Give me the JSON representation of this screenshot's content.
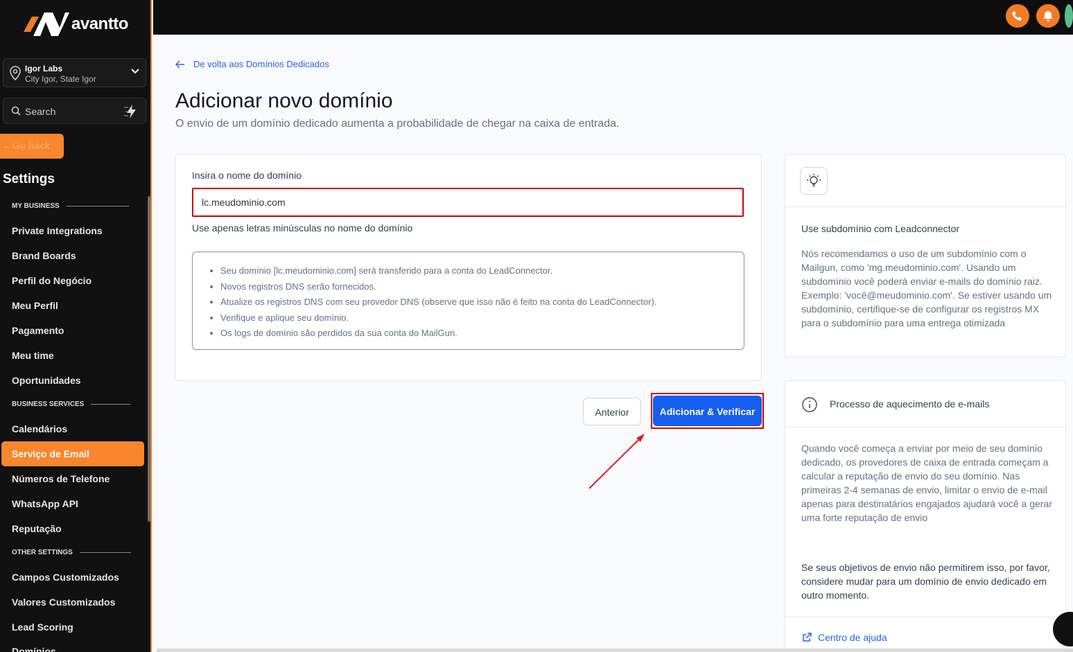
{
  "brand": {
    "name": "avantto"
  },
  "location": {
    "name": "Igor Labs",
    "address": "City Igor, State Igor"
  },
  "search": {
    "label": "Search"
  },
  "sidebar": {
    "go_back": "Go Back",
    "title": "Settings",
    "sections": {
      "my_business": "MY BUSINESS",
      "business_services": "BUSINESS SERVICES",
      "other_settings": "OTHER SETTINGS"
    },
    "items": [
      "Private Integrations",
      "Brand Boards",
      "Perfil do Negócio",
      "Meu Perfil",
      "Pagamento",
      "Meu time",
      "Oportunidades",
      "Calendários",
      "Serviço de Email",
      "Números de Telefone",
      "WhatsApp API",
      "Reputação",
      "Campos Customizados",
      "Valores Customizados",
      "Lead Scoring",
      "Domínios"
    ]
  },
  "main": {
    "back_link": "De volta aos Domínios Dedicados",
    "title": "Adicionar novo domínio",
    "subtitle": "O envio de um domínio dedicado aumenta a probabilidade de chegar na caixa de entrada.",
    "domain_label": "Insira o nome do domínio",
    "domain_value": "lc.meudominio.com",
    "domain_hint": "Use apenas letras minúsculas no nome do domínio",
    "info_items": [
      "Seu domínio [lc.meudominio.com] será transferido para a conta do LeadConnector.",
      "Novos registros DNS serão fornecidos.",
      "Atualize os registros DNS com seu provedor DNS (observe que isso não é feito na conta do LeadConnector).",
      "Verifique e aplique seu domínio.",
      "Os logs de domínio são perdidos da sua conta do MailGun."
    ],
    "btn_prev": "Anterior",
    "btn_submit": "Adicionar & Verificar"
  },
  "tips": {
    "subdomain_title": "Use subdomínio com Leadconnector",
    "subdomain_body": "Nós recomendamos o uso de um subdomínio com o Mailgun, como 'mg.meudominio.com'. Usando um subdomínio você poderá enviar e-mails do domínio raiz. Exemplo: 'você@meudominio.com'. Se estiver usando um subdomínio, certifique-se de configurar os registros MX para o subdomínio para uma entrega otimizada",
    "warmup_title": "Processo de aquecimento de e-mails",
    "warmup_body": "Quando você começa a enviar por meio de seu domínio dedicado, os provedores de caixa de entrada começam a calcular a reputação de envio do seu domínio. Nas primeiras 2-4 semanas de envio, limitar o envio de e-mail apenas para destinatários engajados ajudará você a gerar uma forte reputação de envio",
    "warmup_note": "Se seus objetivos de envio não permitirem isso, por favor, considere mudar para um domínio de envio dedicado em outro momento.",
    "help_link": "Centro de ajuda"
  },
  "colors": {
    "accent": "#f7862d",
    "primary": "#155eef",
    "highlight": "#d40000"
  }
}
